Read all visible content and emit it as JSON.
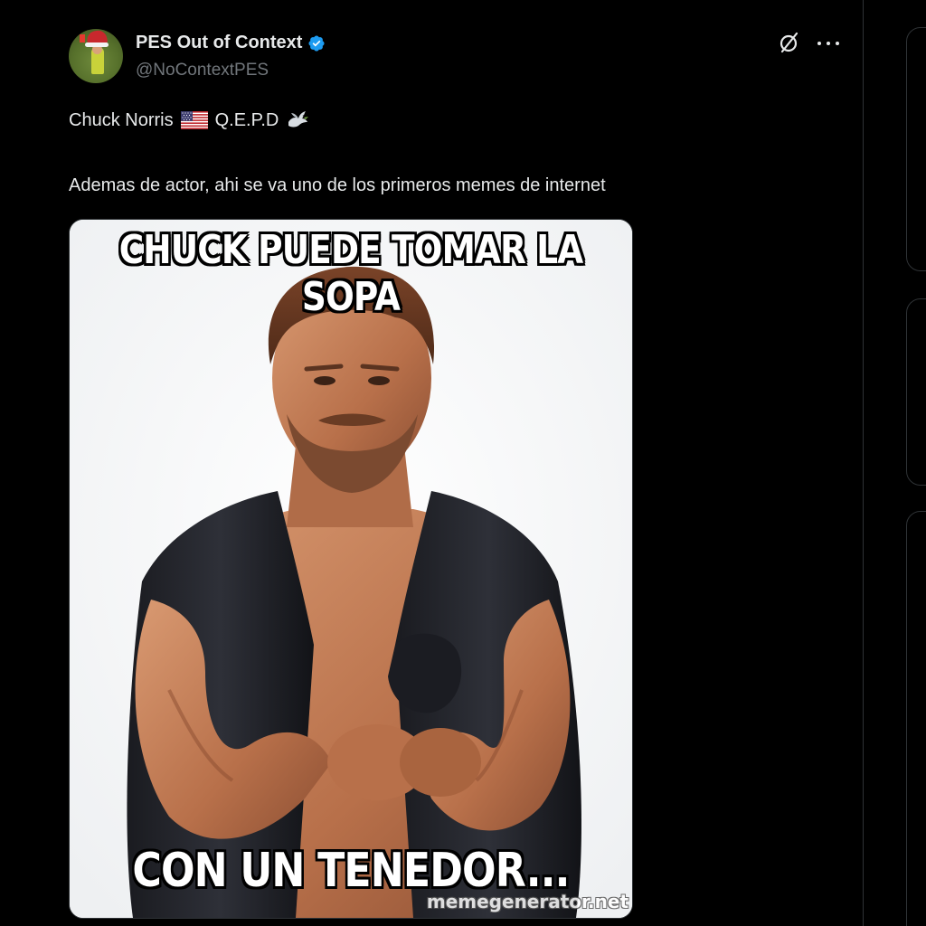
{
  "tweet": {
    "display_name": "PES Out of Context",
    "handle": "@NoContextPES",
    "verified": true,
    "text_line1_before_flag": "Chuck Norris",
    "text_line1_after_flag": "Q.E.P.D",
    "text_line2": "Ademas de actor, ahi se va uno de los primeros memes de internet",
    "icons": {
      "flag": "us-flag-emoji",
      "dove": "dove-emoji",
      "grok": "grok-icon",
      "more": "more-icon",
      "verified": "verified-badge-icon"
    }
  },
  "meme": {
    "top_line1": "CHUCK PUEDE TOMAR LA",
    "top_line2": "SOPA",
    "bottom_text": "CON UN TENEDOR...",
    "watermark": "memegenerator.net"
  },
  "colors": {
    "background": "#000000",
    "text_primary": "#e7e9ea",
    "text_secondary": "#71767b",
    "verified_blue": "#1d9bf0",
    "border": "#2f3336"
  }
}
